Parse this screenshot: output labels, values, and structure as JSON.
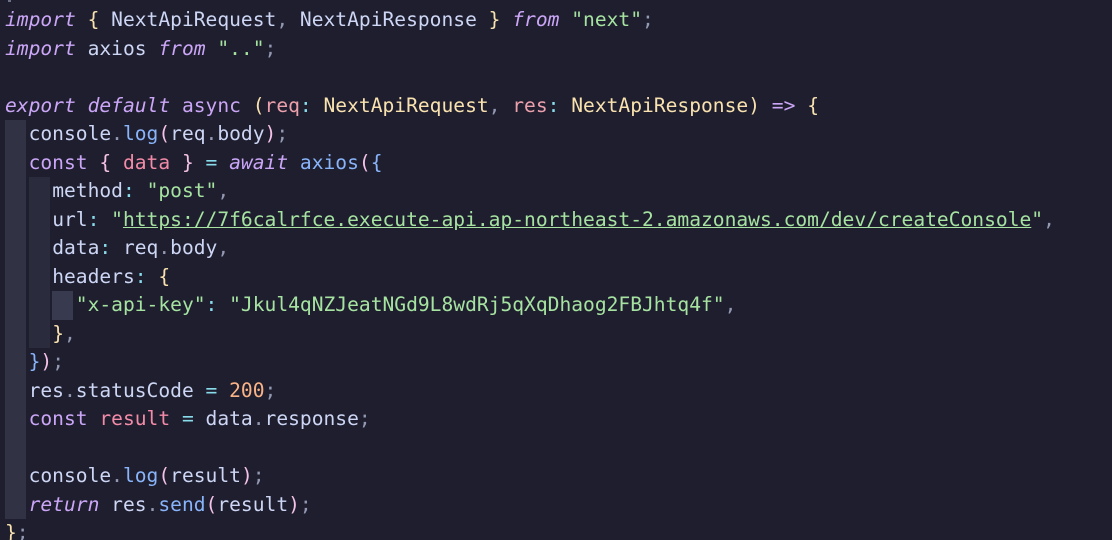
{
  "editor": {
    "language": "typescript",
    "theme_background": "#1e1e2e",
    "lines": [
      {
        "text": "import { NextApiRequest, NextApiResponse } from \"next\";"
      },
      {
        "text": "import axios from \"..\";"
      },
      {
        "text": ""
      },
      {
        "text": "export default async (req: NextApiRequest, res: NextApiResponse) => {"
      },
      {
        "text": "  console.log(req.body);"
      },
      {
        "text": "  const { data } = await axios({"
      },
      {
        "text": "    method: \"post\","
      },
      {
        "text": "    url: \"https://7f6calrfce.execute-api.ap-northeast-2.amazonaws.com/dev/createConsole\","
      },
      {
        "text": "    data: req.body,"
      },
      {
        "text": "    headers: {"
      },
      {
        "text": "      \"x-api-key\": \"Jkul4qNZJeatNGd9L8wdRj5qXqDhaog2FBJhtq4f\","
      },
      {
        "text": "    },"
      },
      {
        "text": "  });"
      },
      {
        "text": "  res.statusCode = 200;"
      },
      {
        "text": "  const result = data.response;"
      },
      {
        "text": ""
      },
      {
        "text": "  console.log(result);"
      },
      {
        "text": "  return res.send(result);"
      },
      {
        "text": "};"
      }
    ]
  },
  "tokens": {
    "import": "import",
    "from": "from",
    "export": "export",
    "default": "default",
    "async": "async",
    "const": "const",
    "await": "await",
    "return": "return",
    "NextApiRequest": "NextApiRequest",
    "NextApiResponse": "NextApiResponse",
    "next_str": "\"next\"",
    "axios": "axios",
    "dots_str": "\"..\"",
    "req": "req",
    "res": "res",
    "console": "console",
    "log": "log",
    "body": "body",
    "data": "data",
    "method": "method",
    "post_str": "\"post\"",
    "url": "url",
    "url_quote": "\"",
    "url_value": "https://7f6calrfce.execute-api.ap-northeast-2.amazonaws.com/dev/createConsole",
    "headers": "headers",
    "api_key_name": "\"x-api-key\"",
    "api_key_value": "\"Jkul4qNZJeatNGd9L8wdRj5qXqDhaog2FBJhtq4f\"",
    "statusCode": "statusCode",
    "status_value": "200",
    "result": "result",
    "response": "response",
    "send": "send"
  }
}
